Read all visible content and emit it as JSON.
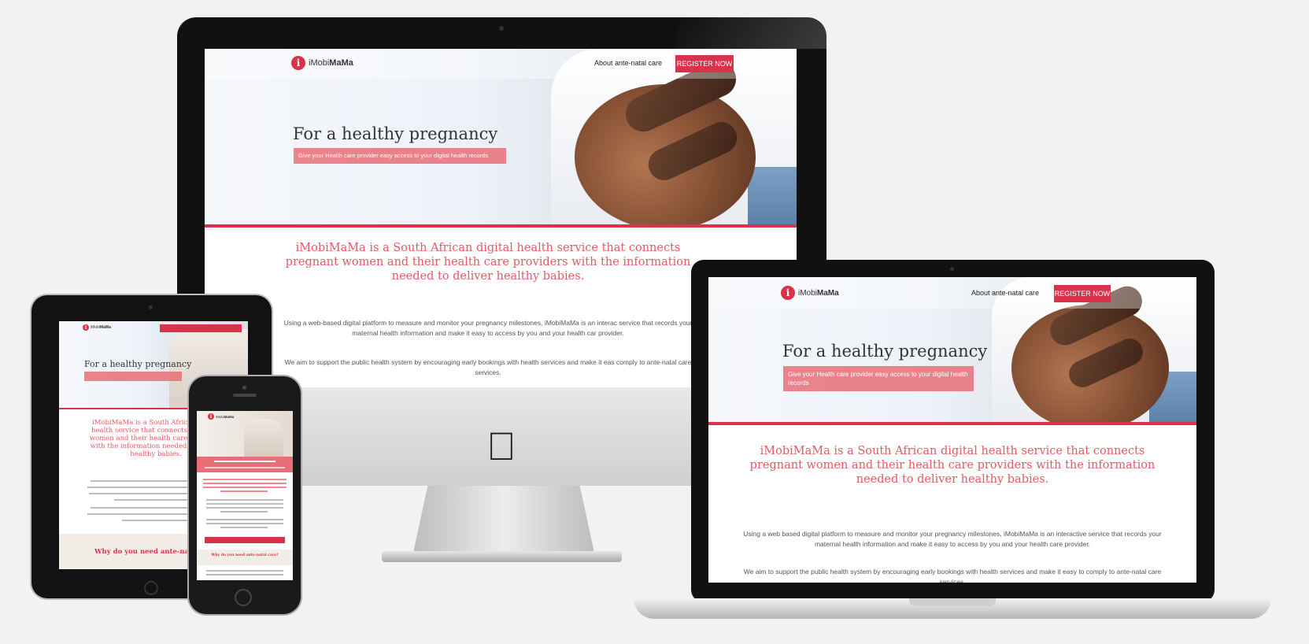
{
  "brand": {
    "name_light": "iMobi",
    "name_bold": "MaMa",
    "icon": "info-icon",
    "icon_glyph": "i"
  },
  "nav": {
    "link": "About ante-natal care",
    "cta": "REGISTER NOW"
  },
  "hero": {
    "title": "For a healthy pregnancy",
    "subtitle": "Give your Health care provider easy access to your digital health records"
  },
  "intro": "iMobiMaMa is a South African digital health service that connects pregnant women and their health care providers with the information needed to deliver healthy babies.",
  "body": {
    "p1_desktop": "Using a web-based digital platform to measure and monitor your pregnancy milestones, iMobiMaMa is an interac service that records your maternal health information and make it easy to access by you and your health car provider.",
    "p2_desktop": "We aim to support the public health system by encouraging early bookings with health services and make it eas comply to ante-natal care services.",
    "p1_laptop": "Using a web based digital platform to measure and monitor your pregnancy milestones, iMobiMaMa is an interactive service that records your maternal health information and make it easy to access by you and your health care provider.",
    "p2_laptop": "We aim to support the public health system by encouraging early bookings with health services and make it easy to comply to ante-natal care services."
  },
  "tablet": {
    "intro": "iMobiMaMa is a South African digital health service that connects pregnant women and their health care providers with the information needed to deliver healthy babies.",
    "section_title": "Why do you need ante-natal"
  },
  "phone": {
    "section_title": "Why do you need ante-natal care?"
  },
  "device_logo": "apple-icon",
  "colors": {
    "accent": "#d8334a",
    "intro_text": "#e35a63",
    "subtitle_bg": "#e86e78",
    "page_bg": "#f2f2f2"
  }
}
